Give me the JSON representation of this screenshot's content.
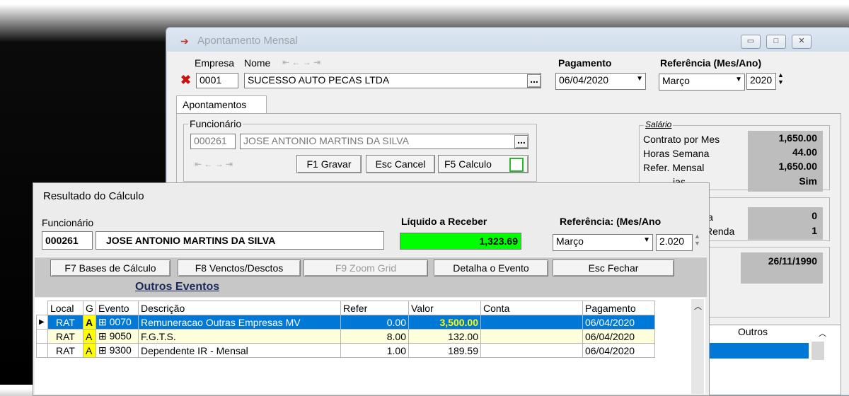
{
  "back_window": {
    "title": "Apontamento Mensal",
    "header": {
      "empresa_label": "Empresa",
      "nome_label": "Nome",
      "empresa_code": "0001",
      "empresa_name": "SUCESSO AUTO PECAS LTDA",
      "pagamento_label": "Pagamento",
      "pagamento_date": "06/04/2020",
      "referencia_label": "Referência (Mes/Ano)",
      "ref_month": "Março",
      "ref_year": "2020"
    },
    "tab": "Apontamentos",
    "funcionario": {
      "group_label": "Funcionário",
      "code": "000261",
      "name": "JOSE ANTONIO MARTINS DA SILVA",
      "gravar": "F1 Gravar",
      "cancel": "Esc Cancel",
      "calculo": "F5 Calculo"
    },
    "salario": {
      "group_label": "Salário",
      "rows": [
        {
          "label": "Contrato por Mes",
          "value": "1,650.00"
        },
        {
          "label": "Horas Semana",
          "value": "44.00"
        },
        {
          "label": "Refer. Mensal",
          "value": "1,650.00"
        },
        {
          "label": "ias",
          "value": "Sim"
        }
      ]
    },
    "other_rows": [
      {
        "label": "ia",
        "value": "0"
      },
      {
        "label": "Renda",
        "value": "1"
      }
    ],
    "date_value": "26/11/1990",
    "outros_header": "Outros"
  },
  "dialog": {
    "title": "Resultado do Cálculo",
    "funcionario_label": "Funcionário",
    "code": "000261",
    "name": "JOSE ANTONIO MARTINS DA SILVA",
    "liquido_label": "Líquido a Receber",
    "liquido_value": "1,323.69",
    "referencia_label": "Referência: (Mes/Ano",
    "ref_month": "Março",
    "ref_year": "2.020",
    "buttons": {
      "bases": "F7 Bases de Cálculo",
      "venctos": "F8 Venctos/Desctos",
      "zoom": "F9 Zoom Grid",
      "detalha": "Detalha o Evento",
      "fechar": "Esc Fechar"
    },
    "section_title": "Outros Eventos",
    "columns": [
      "Local",
      "G",
      "Evento",
      "Descrição",
      "Refer",
      "Valor",
      "Conta",
      "Pagamento"
    ],
    "rows": [
      {
        "local": "RAT",
        "g": "A",
        "evento": "0070",
        "descricao": "Remuneracao Outras Empresas MV",
        "refer": "0.00",
        "valor": "3,500.00",
        "conta": "",
        "pagamento": "06/04/2020"
      },
      {
        "local": "RAT",
        "g": "A",
        "evento": "9050",
        "descricao": "F.G.T.S.",
        "refer": "8.00",
        "valor": "132.00",
        "conta": "",
        "pagamento": "06/04/2020"
      },
      {
        "local": "RAT",
        "g": "A",
        "evento": "9300",
        "descricao": "Dependente IR - Mensal",
        "refer": "1.00",
        "valor": "189.59",
        "conta": "",
        "pagamento": "06/04/2020"
      }
    ]
  },
  "colors": {
    "liquido_bg": "#00ff00",
    "selection": "#0078d7",
    "valor_highlight": "#ffff00"
  }
}
